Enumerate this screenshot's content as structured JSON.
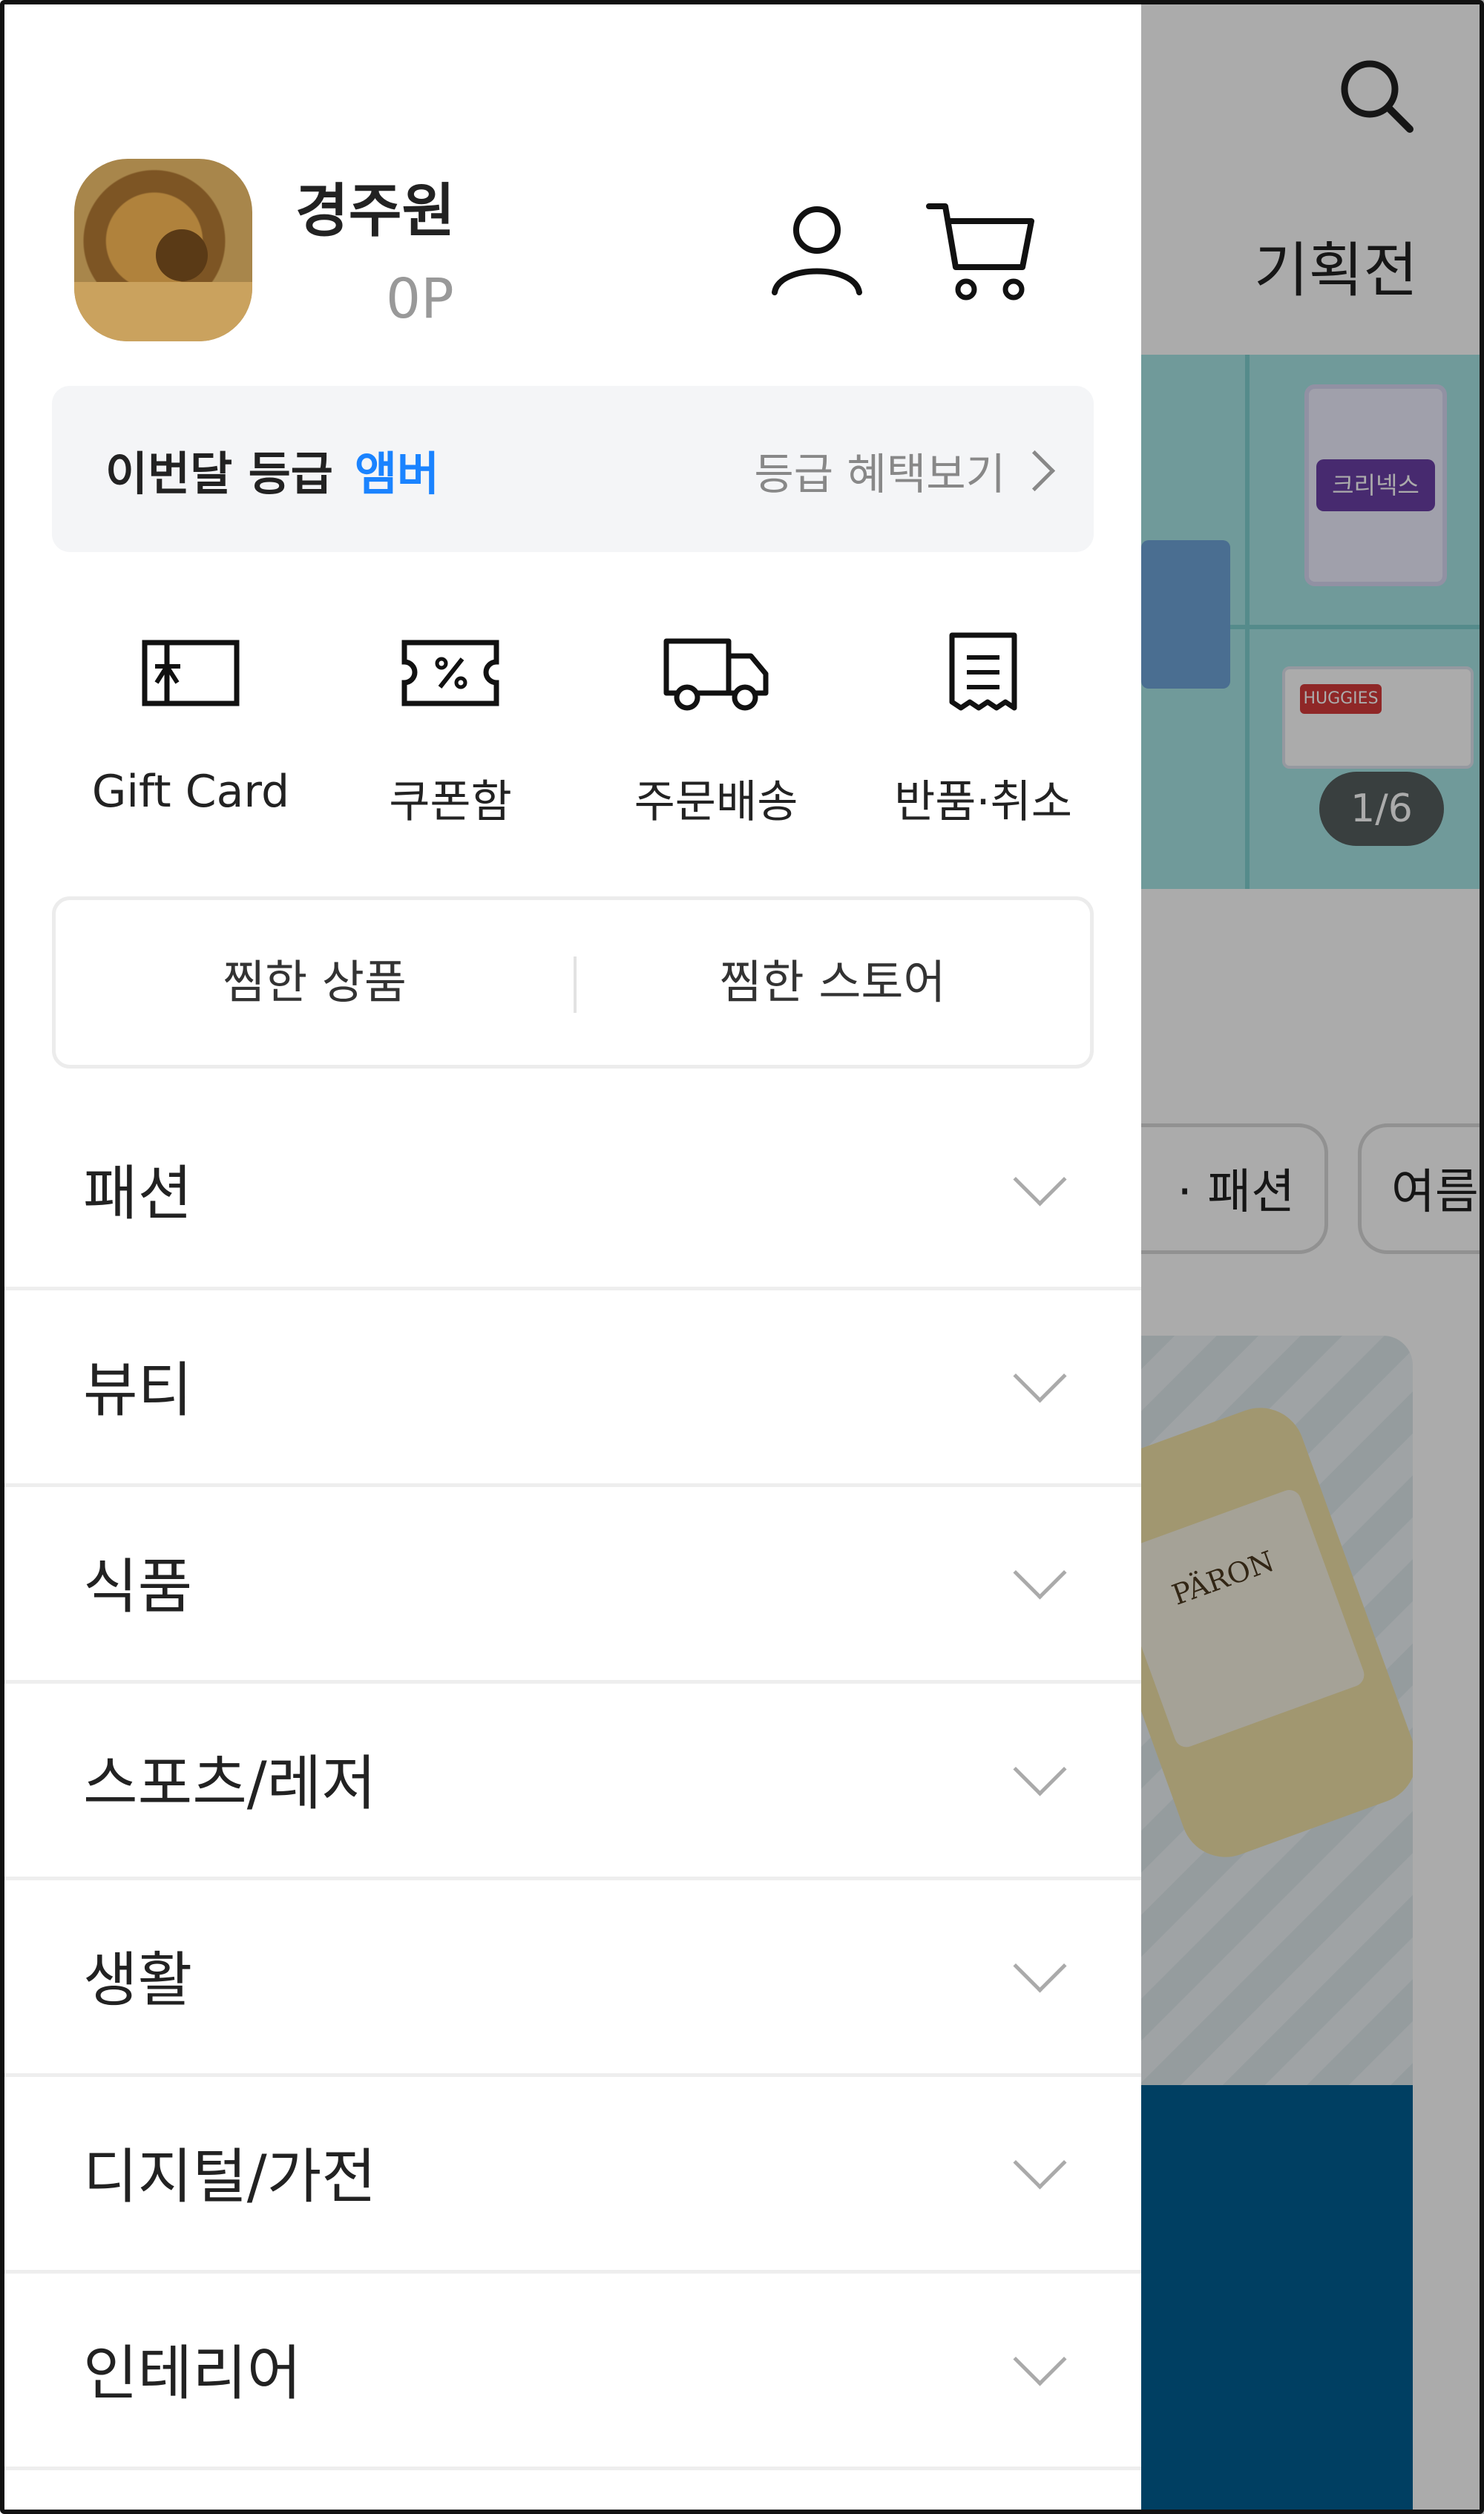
{
  "background": {
    "header_title": "기획전",
    "banner_counter": "1/6",
    "banner_pkg1_text": "크리넥스",
    "banner_pkg3_text": "HUGGIES",
    "chips": [
      "· 패션",
      "여름"
    ],
    "product_label": "PÄRON"
  },
  "drawer": {
    "user": {
      "name": "경주원",
      "points": "0P"
    },
    "grade": {
      "label": "이번달 등급",
      "value": "앰버",
      "link": "등급 혜택보기"
    },
    "quick_menu": [
      {
        "label": "Gift Card",
        "icon": "gift-card-icon"
      },
      {
        "label": "쿠폰함",
        "icon": "coupon-icon"
      },
      {
        "label": "주문배송",
        "icon": "delivery-truck-icon"
      },
      {
        "label": "반품·취소",
        "icon": "receipt-icon"
      }
    ],
    "wishlist": {
      "products": "찜한 상품",
      "stores": "찜한 스토어"
    },
    "categories": [
      {
        "label": "패션"
      },
      {
        "label": "뷰티"
      },
      {
        "label": "식품"
      },
      {
        "label": "스포츠/레저"
      },
      {
        "label": "생활"
      },
      {
        "label": "디지털/가전"
      },
      {
        "label": "인테리어"
      }
    ]
  },
  "colors": {
    "accent": "#1a83ff",
    "overlay": "rgba(0,0,0,0.33)",
    "grade_bg": "#f4f5f7"
  }
}
